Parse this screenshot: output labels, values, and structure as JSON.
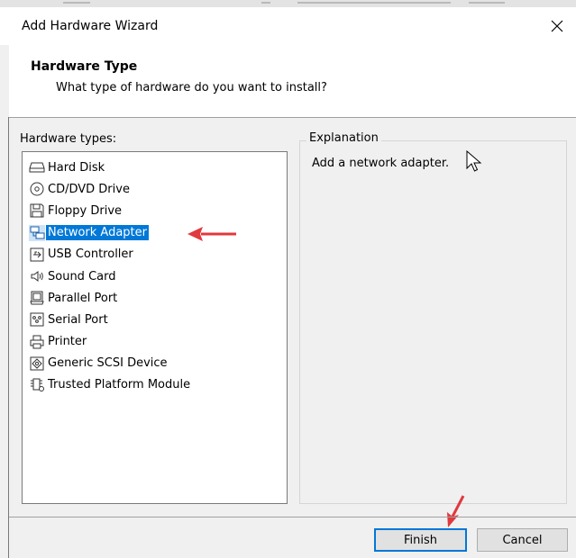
{
  "window": {
    "title": "Add Hardware Wizard",
    "close_icon": "close-icon"
  },
  "header": {
    "title": "Hardware Type",
    "subtitle": "What type of hardware do you want to install?"
  },
  "hardware_types": {
    "label": "Hardware types:",
    "selected": "Network Adapter",
    "items": [
      {
        "label": "Hard Disk",
        "icon": "hard-disk-icon"
      },
      {
        "label": "CD/DVD Drive",
        "icon": "cd-dvd-icon"
      },
      {
        "label": "Floppy Drive",
        "icon": "floppy-icon"
      },
      {
        "label": "Network Adapter",
        "icon": "network-adapter-icon"
      },
      {
        "label": "USB Controller",
        "icon": "usb-icon"
      },
      {
        "label": "Sound Card",
        "icon": "speaker-icon"
      },
      {
        "label": "Parallel Port",
        "icon": "parallel-port-icon"
      },
      {
        "label": "Serial Port",
        "icon": "serial-port-icon"
      },
      {
        "label": "Printer",
        "icon": "printer-icon"
      },
      {
        "label": "Generic SCSI Device",
        "icon": "scsi-icon"
      },
      {
        "label": "Trusted Platform Module",
        "icon": "tpm-icon"
      }
    ]
  },
  "explanation": {
    "legend": "Explanation",
    "text": "Add a network adapter."
  },
  "buttons": {
    "finish": "Finish",
    "cancel": "Cancel"
  },
  "colors": {
    "selection": "#0078d7",
    "annotation_arrow": "#e0393e",
    "window_bg": "#f0f0f0"
  }
}
